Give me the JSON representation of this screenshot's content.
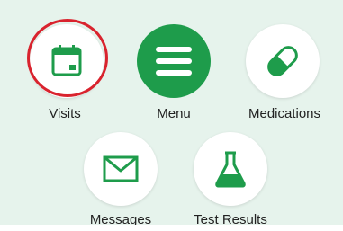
{
  "menu": {
    "items": [
      {
        "id": "visits",
        "label": "Visits",
        "icon": "calendar-icon"
      },
      {
        "id": "menu",
        "label": "Menu",
        "icon": "hamburger-icon"
      },
      {
        "id": "medications",
        "label": "Medications",
        "icon": "pill-icon"
      },
      {
        "id": "messages",
        "label": "Messages",
        "icon": "envelope-icon"
      },
      {
        "id": "test-results",
        "label": "Test Results",
        "icon": "flask-icon"
      }
    ]
  },
  "colors": {
    "brand_green": "#1e9c4b",
    "highlight_red": "#d9232e",
    "panel_bg": "#e6f3ec"
  },
  "highlight": "visits"
}
